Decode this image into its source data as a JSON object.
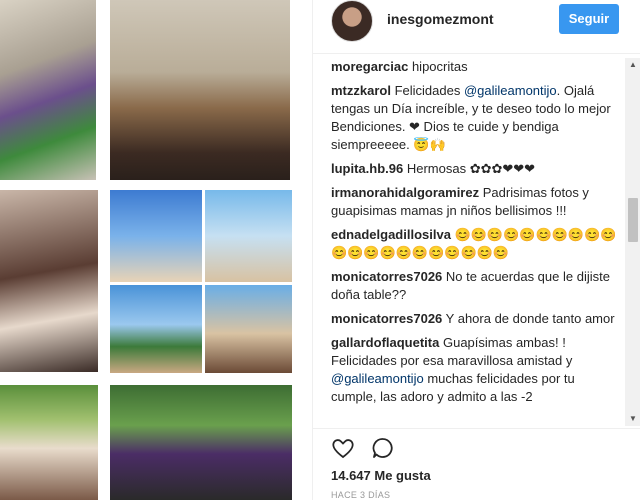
{
  "post": {
    "username": "inesgomezmont",
    "follow_label": "Seguir",
    "likes_text": "14.647 Me gusta",
    "timestamp": "HACE 3 DÍAS"
  },
  "comments": [
    {
      "user": "moregarciac",
      "text": "hipocritas"
    },
    {
      "user": "mtzzkarol",
      "text_before": "Felicidades ",
      "mention": "@galileamontijo",
      "text_after": ". Ojalá tengas un Día increíble, y te deseo todo lo mejor Bendiciones. ❤ Dios te cuide y bendiga siempreeeee. 😇🙌"
    },
    {
      "user": "lupita.hb.96",
      "text": "Hermosas ✿✿✿❤❤❤"
    },
    {
      "user": "irmanorahidalgoramirez",
      "text": "Padrisimas fotos y guapisimas mamas jn niños bellisimos !!!"
    },
    {
      "user": "ednadelgadillosilva",
      "text": "😊😊😊😊😊😊😊😊😊😊😊😊😊😊😊😊😊😊😊😊😊"
    },
    {
      "user": "monicatorres7026",
      "text": "No te acuerdas que le dijiste doña table??"
    },
    {
      "user": "monicatorres7026",
      "text": "Y ahora de donde tanto amor"
    },
    {
      "user": "gallardoflaquetita",
      "text_before": "Guapísimas ambas! ! Felicidades por esa maravillosa amistad y ",
      "mention": "@galileamontijo",
      "text_after": " muchas felicidades por tu cumple, las adoro y admito a las -2"
    }
  ],
  "icons": {
    "heart": "heart-icon",
    "comment": "comment-icon"
  },
  "colors": {
    "accent": "#3897f0",
    "mention": "#003569",
    "text": "#262626"
  }
}
